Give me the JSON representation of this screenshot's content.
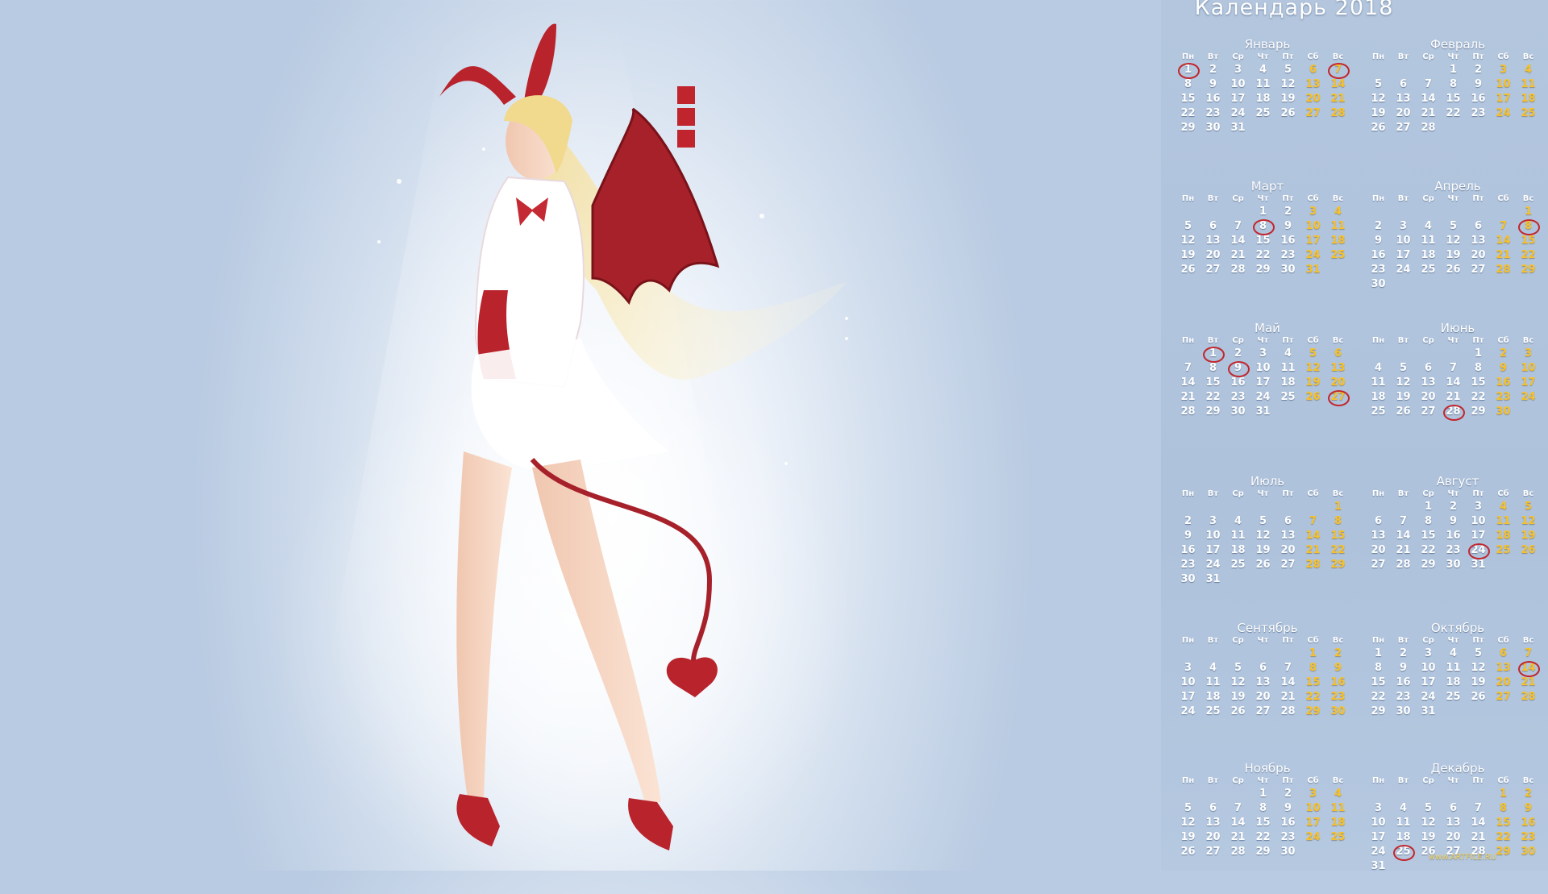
{
  "calendar": {
    "title": "Календарь 2018",
    "weekdays": [
      "Пн",
      "Вт",
      "Ср",
      "Чт",
      "Пт",
      "Сб",
      "Вс"
    ],
    "months": [
      {
        "name": "Январь",
        "offset": 0,
        "days": 31,
        "marked": [
          1,
          7
        ]
      },
      {
        "name": "Февраль",
        "offset": 3,
        "days": 28,
        "marked": []
      },
      {
        "name": "Март",
        "offset": 3,
        "days": 31,
        "marked": [
          8
        ]
      },
      {
        "name": "Апрель",
        "offset": 6,
        "days": 30,
        "marked": [
          8
        ]
      },
      {
        "name": "Май",
        "offset": 1,
        "days": 31,
        "marked": [
          1,
          9,
          27
        ]
      },
      {
        "name": "Июнь",
        "offset": 4,
        "days": 30,
        "marked": [
          28
        ]
      },
      {
        "name": "Июль",
        "offset": 6,
        "days": 31,
        "marked": []
      },
      {
        "name": "Август",
        "offset": 2,
        "days": 31,
        "marked": [
          24
        ]
      },
      {
        "name": "Сентябрь",
        "offset": 5,
        "days": 30,
        "marked": []
      },
      {
        "name": "Октябрь",
        "offset": 0,
        "days": 31,
        "marked": [
          14
        ]
      },
      {
        "name": "Ноябрь",
        "offset": 3,
        "days": 30,
        "marked": []
      },
      {
        "name": "Декабрь",
        "offset": 5,
        "days": 31,
        "marked": [
          25
        ]
      }
    ]
  },
  "watermark": "www.ARTFILE.RU",
  "colors": {
    "weekend": "#f7c12a",
    "marker": "#c1272d",
    "text": "#ffffff"
  },
  "artwork": {
    "seal_icons": [
      "seal-glyph-1",
      "seal-glyph-2",
      "seal-glyph-3"
    ]
  }
}
